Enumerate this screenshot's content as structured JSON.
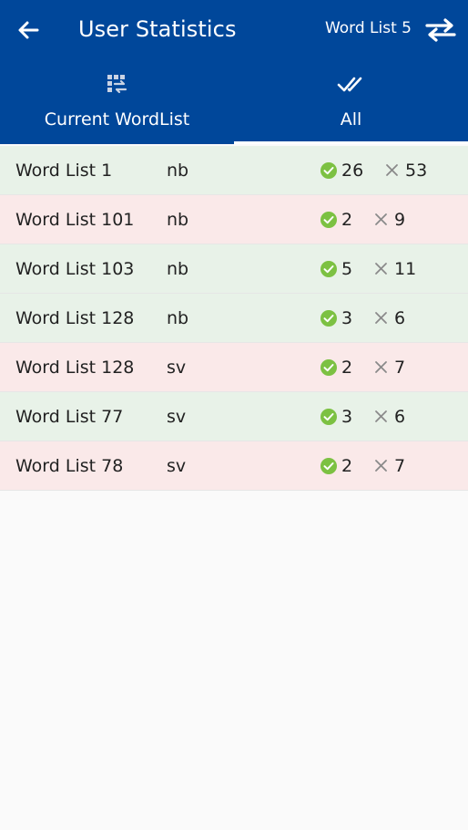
{
  "header": {
    "title": "User Statistics",
    "current_list": "Word List 5"
  },
  "tabs": [
    {
      "label": "Current WordList",
      "icon": "list-swap-icon",
      "active": false
    },
    {
      "label": "All",
      "icon": "double-check-icon",
      "active": true
    }
  ],
  "stats": [
    {
      "name": "Word List 1",
      "lang": "nb",
      "correct": "26",
      "wrong": "53",
      "status": "good"
    },
    {
      "name": "Word List 101",
      "lang": "nb",
      "correct": "2",
      "wrong": "9",
      "status": "bad"
    },
    {
      "name": "Word List 103",
      "lang": "nb",
      "correct": "5",
      "wrong": "11",
      "status": "good"
    },
    {
      "name": "Word List 128",
      "lang": "nb",
      "correct": "3",
      "wrong": "6",
      "status": "good"
    },
    {
      "name": "Word List 128",
      "lang": "sv",
      "correct": "2",
      "wrong": "7",
      "status": "bad"
    },
    {
      "name": "Word List 77",
      "lang": "sv",
      "correct": "3",
      "wrong": "6",
      "status": "good"
    },
    {
      "name": "Word List 78",
      "lang": "sv",
      "correct": "2",
      "wrong": "7",
      "status": "bad"
    }
  ],
  "colors": {
    "primary": "#00479a",
    "row_good": "#e8f2e8",
    "row_bad": "#fae9e9",
    "check_green": "#7cc142",
    "cross_gray": "#8a8a8a"
  }
}
